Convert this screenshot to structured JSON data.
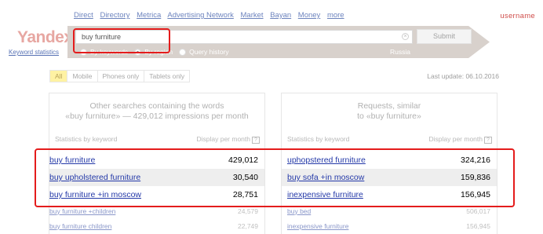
{
  "header": {
    "nav_links": [
      "Direct",
      "Directory",
      "Metrica",
      "Advertising Network",
      "Market",
      "Bayan",
      "Money",
      "more"
    ],
    "username": "username",
    "logo": "Yandex",
    "logo_subtitle": "Keyword statistics"
  },
  "search": {
    "query": "buy furniture",
    "submit_label": "Submit",
    "radio_options": [
      {
        "label": "By keywords",
        "selected": false
      },
      {
        "label": "By region",
        "selected": true
      },
      {
        "label": "Query history",
        "selected": false
      }
    ],
    "region": "Russia"
  },
  "filters": {
    "tabs": [
      "All",
      "Mobile",
      "Phones only",
      "Tablets only"
    ],
    "active": "All",
    "last_update": "Last update: 06.10.2016"
  },
  "left_panel": {
    "heading_line1": "Other searches containing the words",
    "heading_line2": "«buy furniture» — 429,012 impressions per month",
    "col_keyword": "Statistics by keyword",
    "col_display": "Display per month",
    "rows": [
      {
        "keyword": "buy furniture",
        "count": "429,012"
      },
      {
        "keyword": "buy upholstered furniture",
        "count": "30,540"
      },
      {
        "keyword": "buy furniture +in moscow",
        "count": "28,751"
      },
      {
        "keyword": "buy furniture +children",
        "count": "24,579"
      },
      {
        "keyword": "buy furniture children",
        "count": "22,749"
      }
    ]
  },
  "right_panel": {
    "heading_line1": "Requests, similar",
    "heading_line2": "to «buy furniture»",
    "col_keyword": "Statistics by keyword",
    "col_display": "Display per month",
    "rows": [
      {
        "keyword": "uphopstered furniture",
        "count": "324,216"
      },
      {
        "keyword": "buy sofa +in moscow",
        "count": "159,836"
      },
      {
        "keyword": "inexpensive furniture",
        "count": "156,945"
      },
      {
        "keyword": "buy bed",
        "count": "506,017"
      },
      {
        "keyword": "inexpensive furniture",
        "count": "156,945"
      }
    ]
  },
  "colors": {
    "highlight_box": "#e41c1c",
    "link": "#2439a8",
    "active_tab": "#fff2a3"
  }
}
